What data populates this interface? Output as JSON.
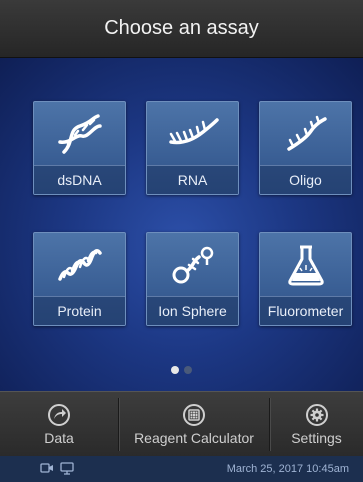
{
  "header": {
    "title": "Choose an assay"
  },
  "tiles": [
    {
      "label": "dsDNA"
    },
    {
      "label": "RNA"
    },
    {
      "label": "Oligo"
    },
    {
      "label": "Protein"
    },
    {
      "label": "Ion Sphere"
    },
    {
      "label": "Fluorometer"
    }
  ],
  "pagination": {
    "pages": 2,
    "current": 1
  },
  "toolbar": {
    "data_label": "Data",
    "reagent_label": "Reagent Calculator",
    "settings_label": "Settings"
  },
  "status": {
    "datetime": "March 25, 2017 10:45am"
  },
  "colors": {
    "accent": "#2c4fa8",
    "tile": "#3a5f95",
    "status_bar": "#1c2f4f"
  }
}
